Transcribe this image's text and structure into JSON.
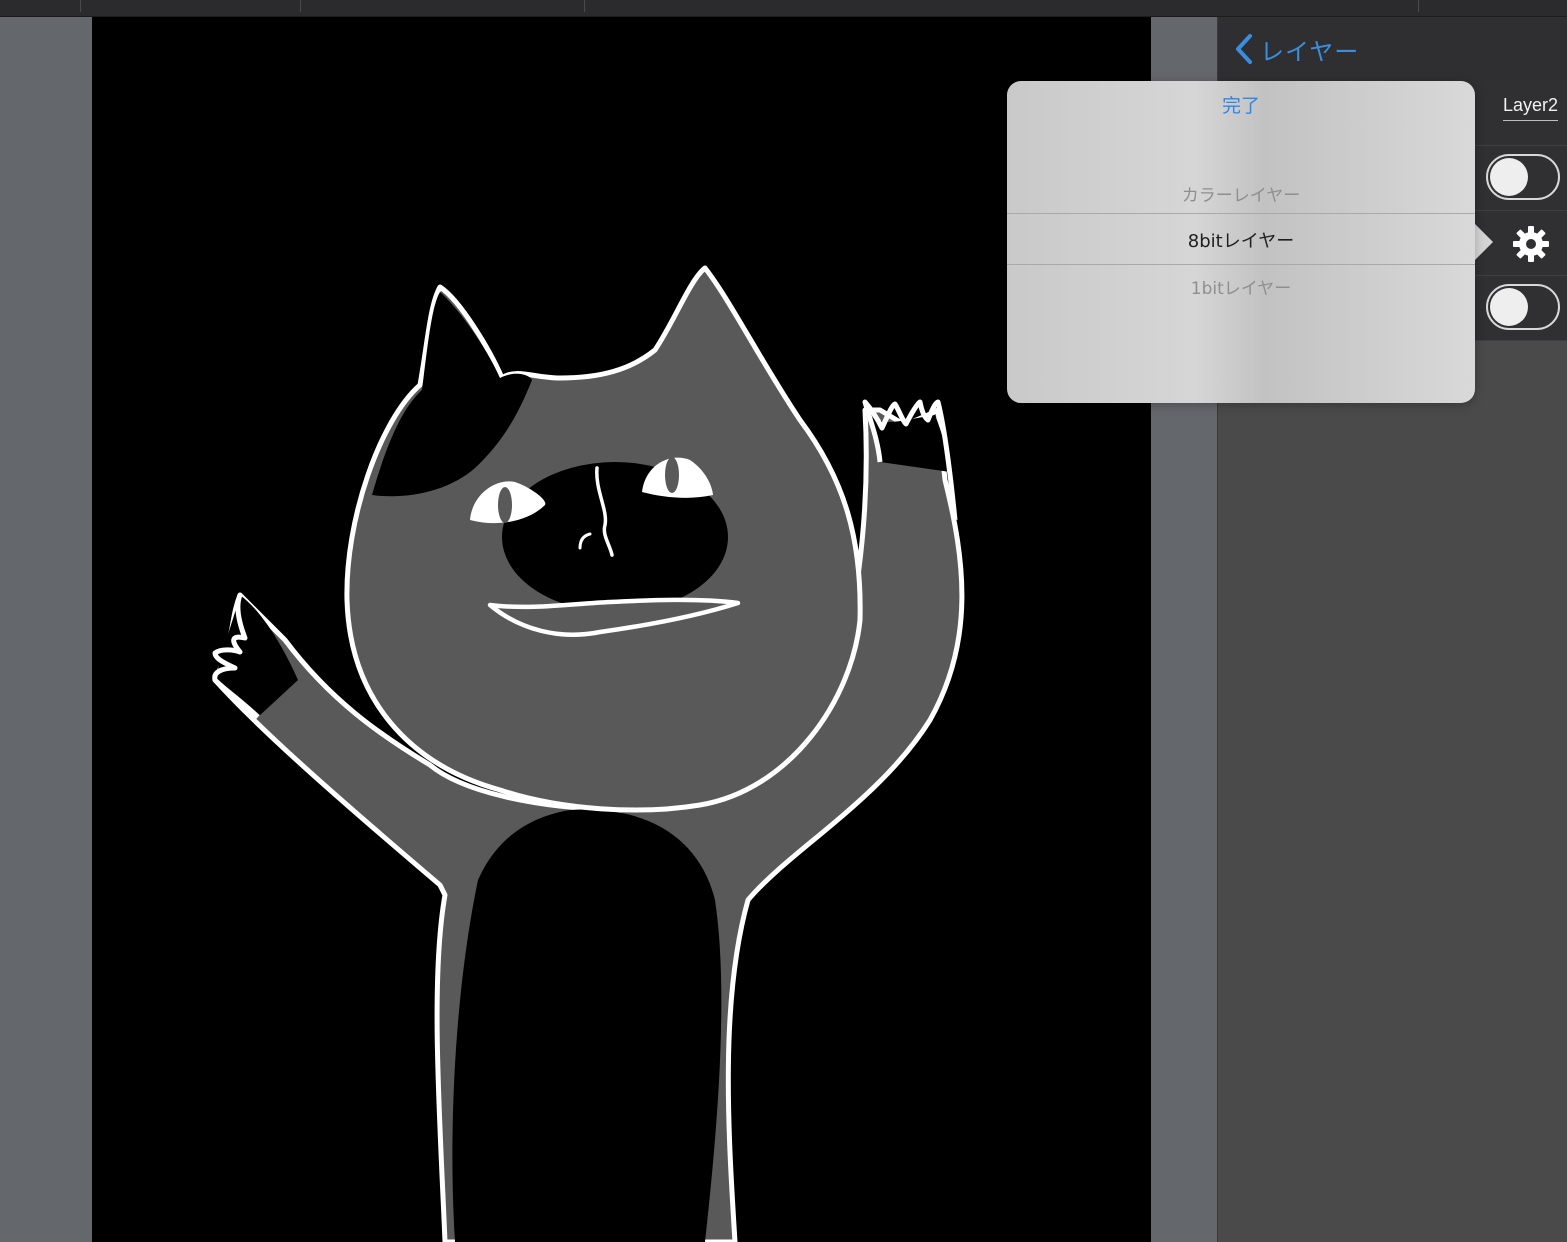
{
  "panel": {
    "back_label": "レイヤー",
    "layer_name": "Layer2"
  },
  "popover": {
    "done_label": "完了",
    "options": [
      {
        "label": "カラーレイヤー",
        "selected": false
      },
      {
        "label": "8bitレイヤー",
        "selected": true
      },
      {
        "label": "1bitレイヤー",
        "selected": false
      }
    ]
  },
  "toggles": [
    {
      "name": "layer-visibility-toggle",
      "on": false
    },
    {
      "name": "layer-lock-toggle",
      "on": false
    }
  ],
  "icons": [
    "chevron-left-icon",
    "gear-icon"
  ],
  "colors": {
    "accent": "#2f86e6",
    "canvas_bg": "#000000",
    "panel_bg": "#4a4a4a"
  }
}
